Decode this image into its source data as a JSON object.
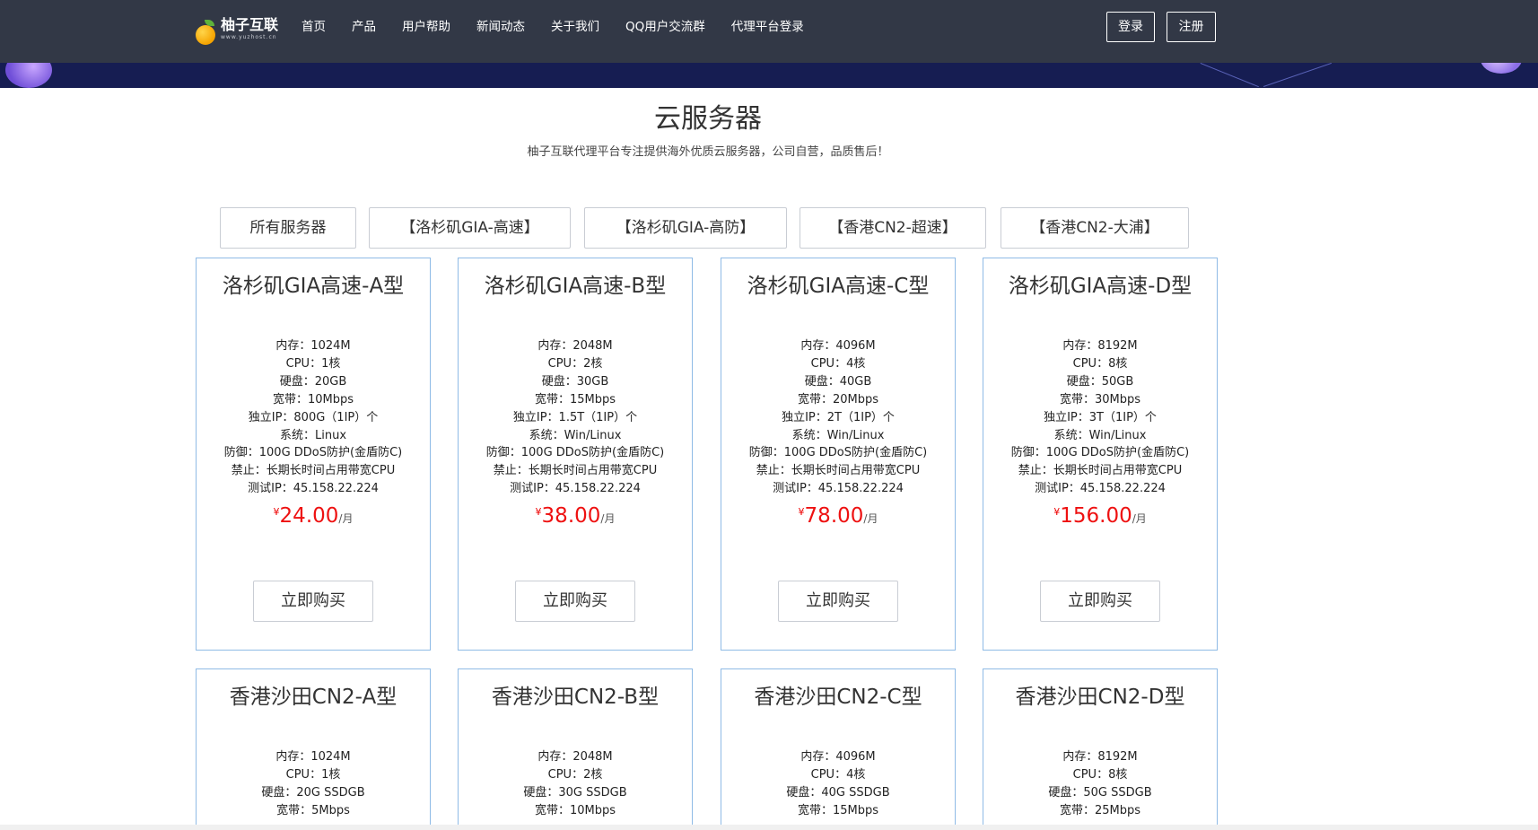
{
  "navbar": {
    "logo_name": "柚子互联",
    "logo_url": "www.yuzhost.cn",
    "items": [
      {
        "label": "首页"
      },
      {
        "label": "产品"
      },
      {
        "label": "用户帮助"
      },
      {
        "label": "新闻动态"
      },
      {
        "label": "关于我们"
      },
      {
        "label": "QQ用户交流群"
      },
      {
        "label": "代理平台登录"
      }
    ],
    "login_label": "登录",
    "register_label": "注册"
  },
  "section": {
    "title": "云服务器",
    "subtitle": "柚子互联代理平台专注提供海外优质云服务器，公司自营，品质售后！"
  },
  "tabs": [
    {
      "label": "所有服务器"
    },
    {
      "label": "【洛杉矶GIA-高速】"
    },
    {
      "label": "【洛杉矶GIA-高防】"
    },
    {
      "label": "【香港CN2-超速】"
    },
    {
      "label": "【香港CN2-大浦】"
    }
  ],
  "cards_row1": [
    {
      "title": "洛杉矶GIA高速-A型",
      "specs": [
        "内存：1024M",
        "CPU：1核",
        "硬盘：20GB",
        "宽带：10Mbps",
        "独立IP：800G（1IP）个",
        "系统：Linux",
        "防御：100G DDoS防护(金盾防C)",
        "禁止：长期长时间占用带宽CPU",
        "测试IP：45.158.22.224"
      ],
      "currency": "¥",
      "price": "24.00",
      "unit": "/月",
      "buy_label": "立即购买"
    },
    {
      "title": "洛杉矶GIA高速-B型",
      "specs": [
        "内存：2048M",
        "CPU：2核",
        "硬盘：30GB",
        "宽带：15Mbps",
        "独立IP：1.5T（1IP）个",
        "系统：Win/Linux",
        "防御：100G DDoS防护(金盾防C)",
        "禁止：长期长时间占用带宽CPU",
        "测试IP：45.158.22.224"
      ],
      "currency": "¥",
      "price": "38.00",
      "unit": "/月",
      "buy_label": "立即购买"
    },
    {
      "title": "洛杉矶GIA高速-C型",
      "specs": [
        "内存：4096M",
        "CPU：4核",
        "硬盘：40GB",
        "宽带：20Mbps",
        "独立IP：2T（1IP）个",
        "系统：Win/Linux",
        "防御：100G DDoS防护(金盾防C)",
        "禁止：长期长时间占用带宽CPU",
        "测试IP：45.158.22.224"
      ],
      "currency": "¥",
      "price": "78.00",
      "unit": "/月",
      "buy_label": "立即购买"
    },
    {
      "title": "洛杉矶GIA高速-D型",
      "specs": [
        "内存：8192M",
        "CPU：8核",
        "硬盘：50GB",
        "宽带：30Mbps",
        "独立IP：3T（1IP）个",
        "系统：Win/Linux",
        "防御：100G DDoS防护(金盾防C)",
        "禁止：长期长时间占用带宽CPU",
        "测试IP：45.158.22.224"
      ],
      "currency": "¥",
      "price": "156.00",
      "unit": "/月",
      "buy_label": "立即购买"
    }
  ],
  "cards_row2": [
    {
      "title": "香港沙田CN2-A型",
      "specs": [
        "内存：1024M",
        "CPU：1核",
        "硬盘：20G SSDGB",
        "宽带：5Mbps"
      ]
    },
    {
      "title": "香港沙田CN2-B型",
      "specs": [
        "内存：2048M",
        "CPU：2核",
        "硬盘：30G SSDGB",
        "宽带：10Mbps"
      ]
    },
    {
      "title": "香港沙田CN2-C型",
      "specs": [
        "内存：4096M",
        "CPU：4核",
        "硬盘：40G SSDGB",
        "宽带：15Mbps"
      ]
    },
    {
      "title": "香港沙田CN2-D型",
      "specs": [
        "内存：8192M",
        "CPU：8核",
        "硬盘：50G SSDGB",
        "宽带：25Mbps"
      ]
    }
  ]
}
